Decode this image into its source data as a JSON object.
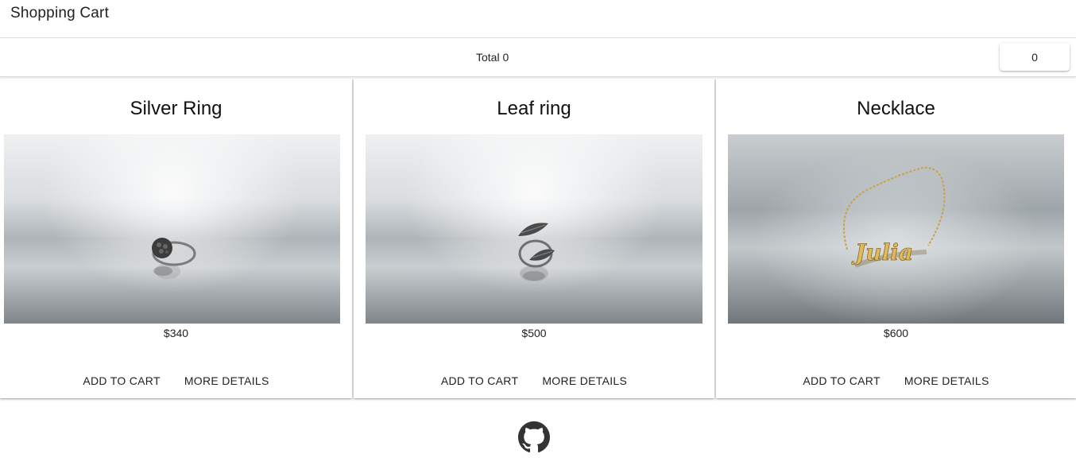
{
  "header": {
    "title": "Shopping Cart"
  },
  "summary": {
    "total_label": "Total 0",
    "cart_count": "0"
  },
  "products": [
    {
      "name": "Silver Ring",
      "price": "$340",
      "add_label": "ADD TO CART",
      "details_label": "MORE DETAILS"
    },
    {
      "name": "Leaf ring",
      "price": "$500",
      "add_label": "ADD TO CART",
      "details_label": "MORE DETAILS"
    },
    {
      "name": "Necklace",
      "price": "$600",
      "add_label": "ADD TO CART",
      "details_label": "MORE DETAILS"
    }
  ],
  "footer": {
    "icon": "github-icon"
  },
  "colors": {
    "text": "#212121",
    "divider": "#e0e0e0",
    "necklace_gold": "#d9b45a"
  }
}
